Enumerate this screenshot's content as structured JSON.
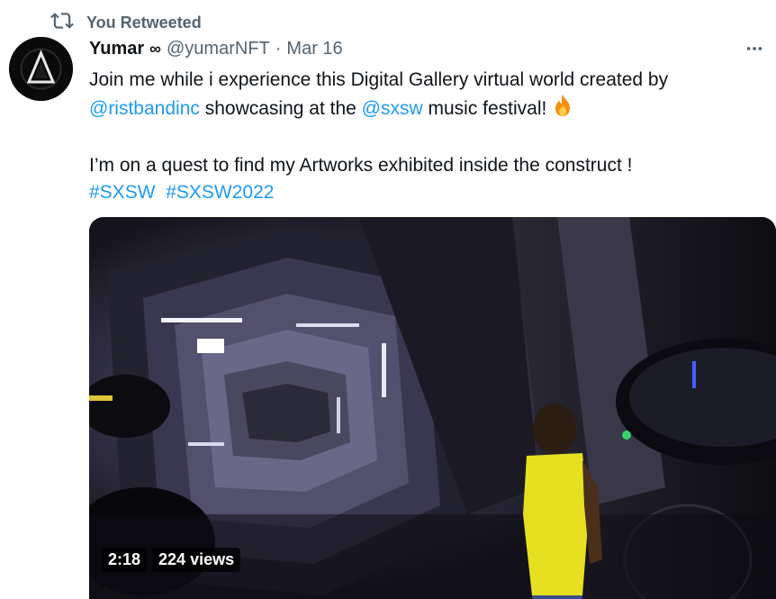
{
  "retweet": {
    "label": "You Retweeted",
    "icon": "retweet-icon"
  },
  "author": {
    "name": "Yumar",
    "badge": "∞",
    "handle": "@yumarNFT",
    "separator": "·",
    "date": "Mar 16",
    "avatar_icon": "triangle-logo-icon"
  },
  "more_icon": "more-horizontal-icon",
  "tweet": {
    "line1_text": "Join me while i experience this Digital Gallery virtual world created by",
    "mention1": "@ristbandinc",
    "line2_mid": " showcasing at the ",
    "mention2": "@sxsw",
    "line2_end": " music festival! ",
    "emoji_icon": "fire-emoji-icon",
    "line3_text": "I’m on a quest to find my Artworks exhibited inside the construct !",
    "hashtag1": "#SXSW",
    "hashtag2": "#SXSW2022"
  },
  "video": {
    "duration": "2:18",
    "views": "224 views"
  },
  "colors": {
    "link": "#1d9bf0",
    "secondary": "#536471",
    "text": "#0f1419"
  }
}
